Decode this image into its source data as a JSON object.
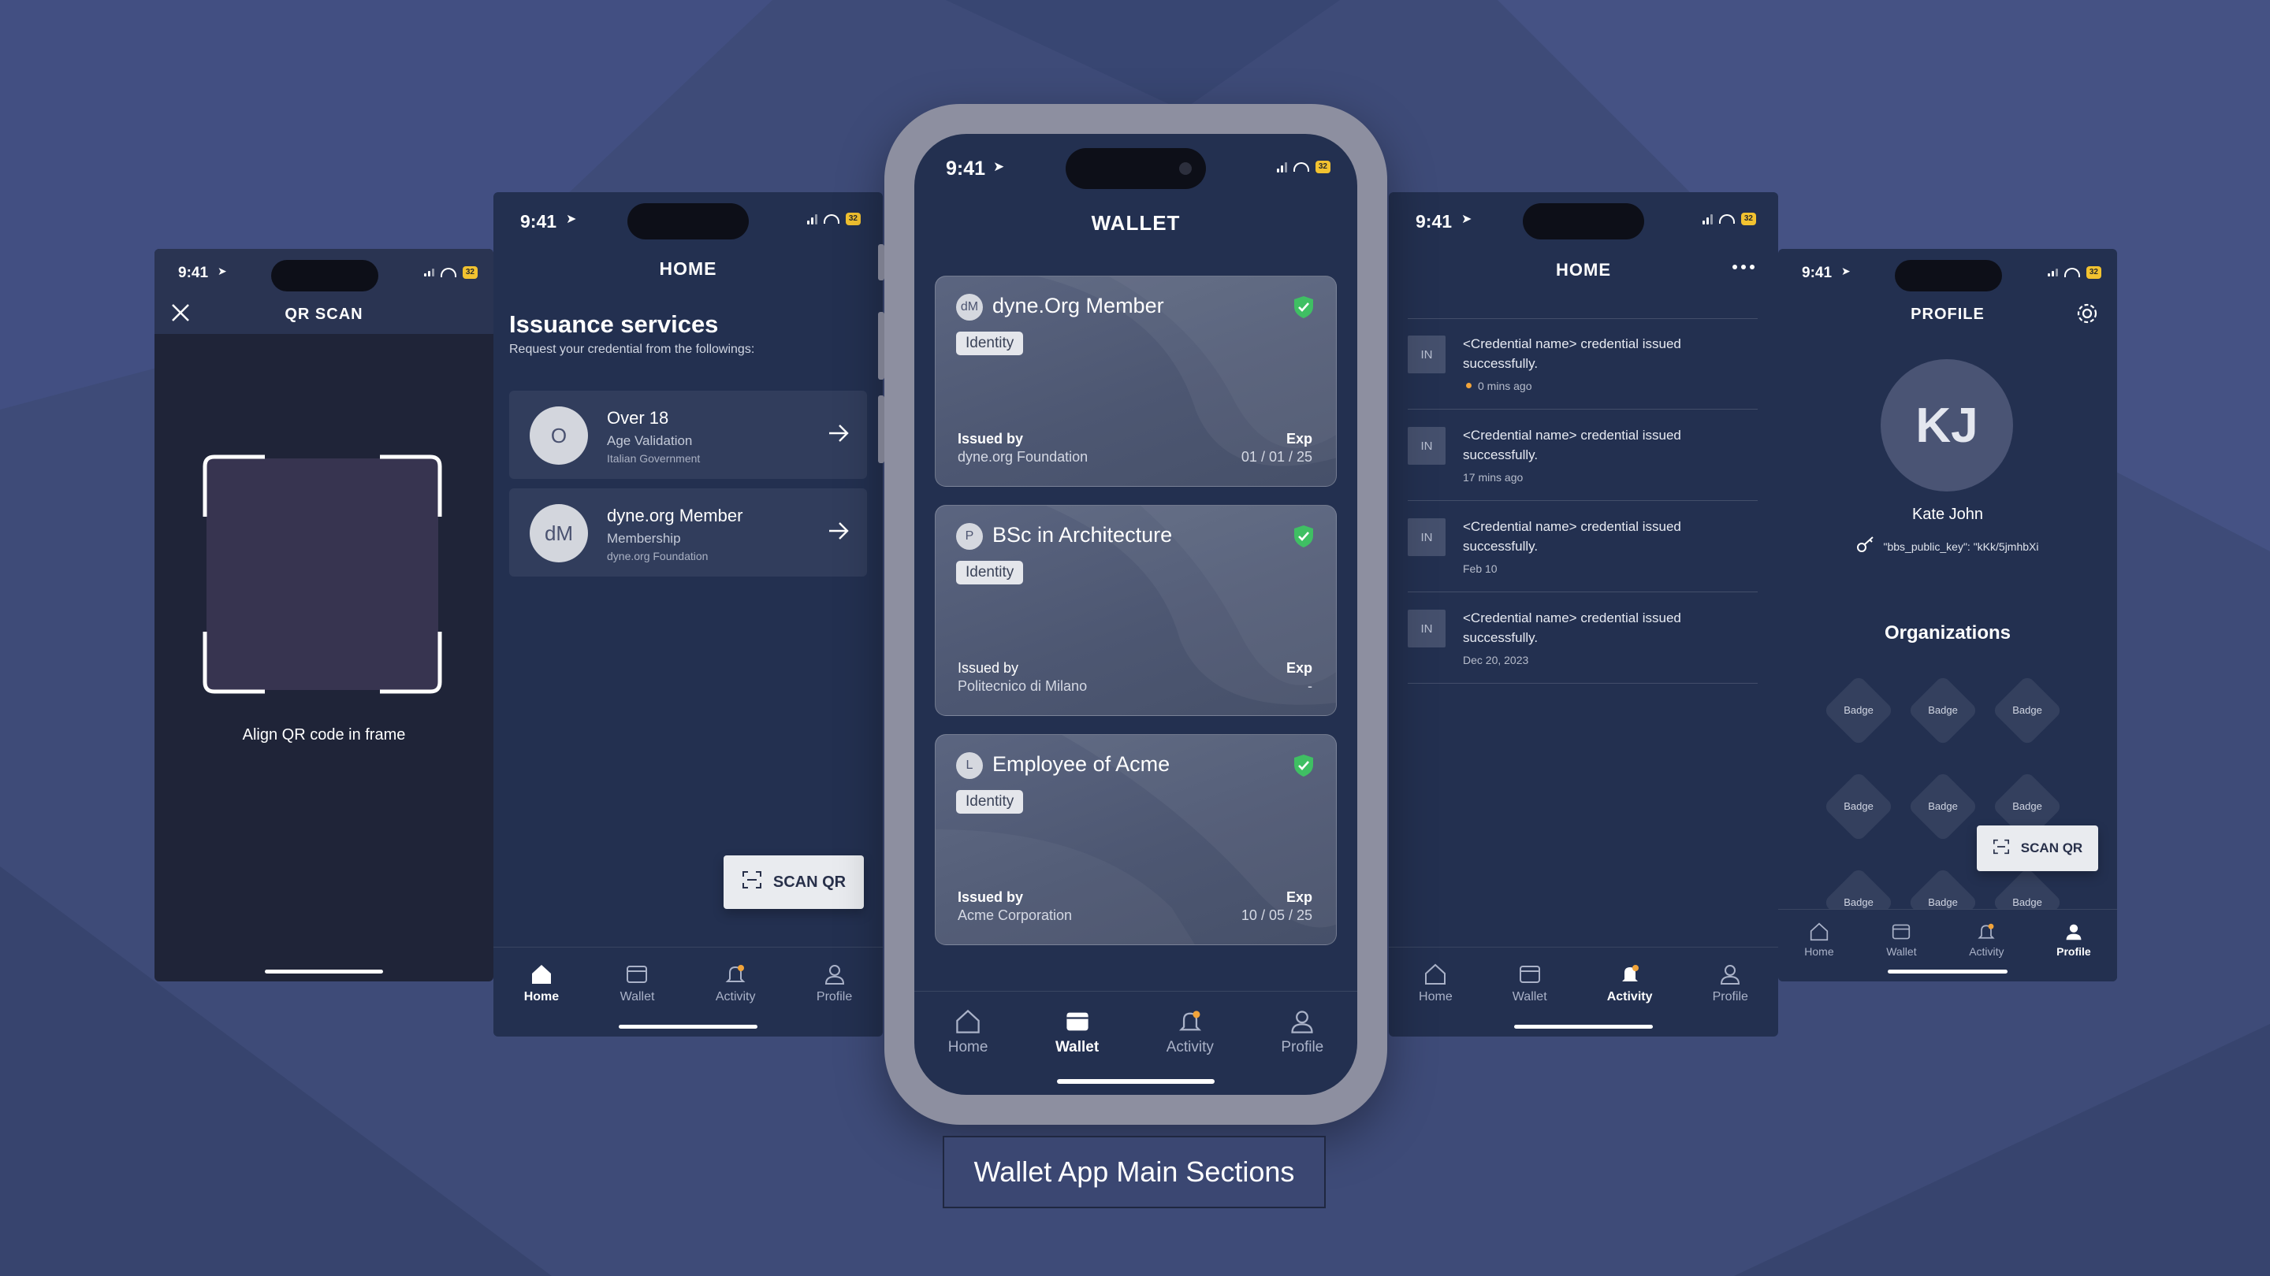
{
  "colors": {
    "background": "#3e4b78",
    "screen": "#233050",
    "card": "#505a75",
    "verified": "#3fbf63",
    "notification_dot": "#f2a43a"
  },
  "caption": "Wallet App Main Sections",
  "status": {
    "time": "9:41",
    "battery": "32"
  },
  "qr_screen": {
    "title": "QR SCAN",
    "instruction": "Align QR code in frame",
    "close_icon": "close-icon"
  },
  "home_screen": {
    "title": "HOME",
    "section_title": "Issuance services",
    "section_subtitle": "Request your credential from the followings:",
    "services": [
      {
        "avatar": "O",
        "name": "Over 18",
        "type": "Age Validation",
        "issuer": "Italian Government"
      },
      {
        "avatar": "dM",
        "name": "dyne.org Member",
        "type": "Membership",
        "issuer": "dyne.org Foundation"
      }
    ],
    "scan_label": "SCAN QR",
    "nav": [
      "Home",
      "Wallet",
      "Activity",
      "Profile"
    ],
    "active_tab": "Home"
  },
  "wallet_screen": {
    "title": "WALLET",
    "issued_by_label": "Issued by",
    "exp_label": "Exp",
    "credentials": [
      {
        "avatar": "dM",
        "name": "dyne.Org Member",
        "tag": "Identity",
        "issuer": "dyne.org Foundation",
        "exp": "01 / 01 / 25"
      },
      {
        "avatar": "P",
        "name": "BSc in Architecture",
        "tag": "Identity",
        "issuer": "Politecnico di Milano",
        "exp": "-"
      },
      {
        "avatar": "L",
        "name": "Employee of Acme",
        "tag": "Identity",
        "issuer": "Acme Corporation",
        "exp": "10 / 05 / 25"
      }
    ],
    "nav": [
      "Home",
      "Wallet",
      "Activity",
      "Profile"
    ],
    "active_tab": "Wallet"
  },
  "activity_screen": {
    "title": "HOME",
    "more_icon": "more-icon",
    "items": [
      {
        "avatar": "IN",
        "message": "<Credential name> credential issued successfully.",
        "time": "0 mins ago",
        "unread": true
      },
      {
        "avatar": "IN",
        "message": "<Credential name> credential issued successfully.",
        "time": "17 mins ago",
        "unread": false
      },
      {
        "avatar": "IN",
        "message": "<Credential name> credential issued successfully.",
        "time": "Feb 10",
        "unread": false
      },
      {
        "avatar": "IN",
        "message": "<Credential name> credential issued successfully.",
        "time": "Dec 20, 2023",
        "unread": false
      }
    ],
    "nav": [
      "Home",
      "Wallet",
      "Activity",
      "Profile"
    ],
    "active_tab": "Activity"
  },
  "profile_screen": {
    "title": "PROFILE",
    "initials": "KJ",
    "name": "Kate John",
    "public_key": "\"bbs_public_key\": \"kKk/5jmhbXi",
    "organizations_title": "Organizations",
    "badges": [
      "Badge",
      "Badge",
      "Badge",
      "Badge",
      "Badge",
      "Badge",
      "Badge",
      "Badge",
      "Badge"
    ],
    "scan_label": "SCAN QR",
    "nav": [
      "Home",
      "Wallet",
      "Activity",
      "Profile"
    ],
    "active_tab": "Profile"
  }
}
